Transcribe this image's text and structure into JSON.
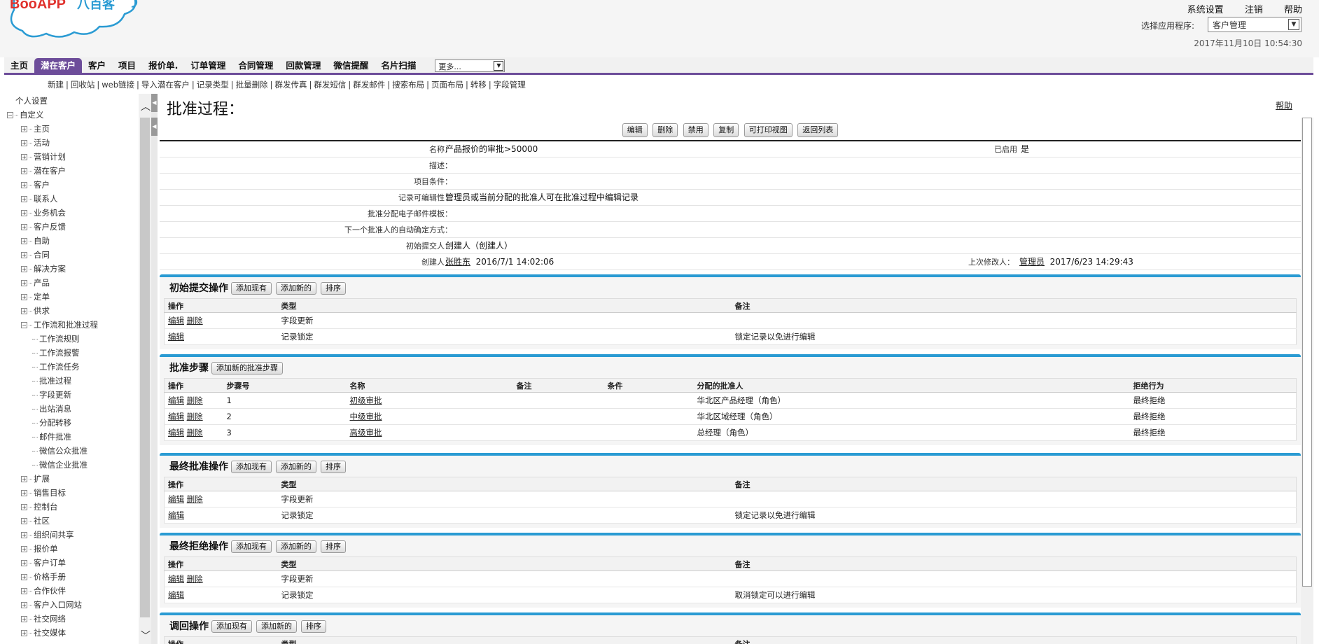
{
  "header": {
    "logo_text": "BooAPP八百客",
    "top_links": [
      "系统设置",
      "注销",
      "帮助"
    ],
    "app_select_label": "选择应用程序:",
    "app_select_value": "客户管理",
    "datetime": "2017年11月10日 10:54:30"
  },
  "nav": {
    "tabs": [
      "主页",
      "潜在客户",
      "客户",
      "项目",
      "报价单.",
      "订单管理",
      "合同管理",
      "回款管理",
      "微信提醒",
      "名片扫描"
    ],
    "active_tab": "潜在客户",
    "more_select": "更多...",
    "sub_links": [
      "新建",
      "回收站",
      "web链接",
      "导入潜在客户",
      "记录类型",
      "批量删除",
      "群发传真",
      "群发短信",
      "群发邮件",
      "搜索布局",
      "页面布局",
      "转移",
      "字段管理"
    ]
  },
  "sidebar": {
    "nodes": [
      {
        "label": "个人设置",
        "level": 0,
        "icon": "none"
      },
      {
        "label": "自定义",
        "level": 0,
        "icon": "minus"
      },
      {
        "label": "主页",
        "level": 1,
        "icon": "plus"
      },
      {
        "label": "活动",
        "level": 1,
        "icon": "plus"
      },
      {
        "label": "营销计划",
        "level": 1,
        "icon": "plus"
      },
      {
        "label": "潜在客户",
        "level": 1,
        "icon": "plus"
      },
      {
        "label": "客户",
        "level": 1,
        "icon": "plus"
      },
      {
        "label": "联系人",
        "level": 1,
        "icon": "plus"
      },
      {
        "label": "业务机会",
        "level": 1,
        "icon": "plus"
      },
      {
        "label": "客户反馈",
        "level": 1,
        "icon": "plus"
      },
      {
        "label": "自助",
        "level": 1,
        "icon": "plus"
      },
      {
        "label": "合同",
        "level": 1,
        "icon": "plus"
      },
      {
        "label": "解决方案",
        "level": 1,
        "icon": "plus"
      },
      {
        "label": "产品",
        "level": 1,
        "icon": "plus"
      },
      {
        "label": "定单",
        "level": 1,
        "icon": "plus"
      },
      {
        "label": "供求",
        "level": 1,
        "icon": "plus"
      },
      {
        "label": "工作流和批准过程",
        "level": 1,
        "icon": "minus"
      },
      {
        "label": "工作流规则",
        "level": 2,
        "icon": "line"
      },
      {
        "label": "工作流报警",
        "level": 2,
        "icon": "line"
      },
      {
        "label": "工作流任务",
        "level": 2,
        "icon": "line"
      },
      {
        "label": "批准过程",
        "level": 2,
        "icon": "line"
      },
      {
        "label": "字段更新",
        "level": 2,
        "icon": "line"
      },
      {
        "label": "出站消息",
        "level": 2,
        "icon": "line"
      },
      {
        "label": "分配转移",
        "level": 2,
        "icon": "line"
      },
      {
        "label": "邮件批准",
        "level": 2,
        "icon": "line"
      },
      {
        "label": "微信公众批准",
        "level": 2,
        "icon": "line"
      },
      {
        "label": "微信企业批准",
        "level": 2,
        "icon": "line"
      },
      {
        "label": "扩展",
        "level": 1,
        "icon": "plus"
      },
      {
        "label": "销售目标",
        "level": 1,
        "icon": "plus"
      },
      {
        "label": "控制台",
        "level": 1,
        "icon": "plus"
      },
      {
        "label": "社区",
        "level": 1,
        "icon": "plus"
      },
      {
        "label": "组织间共享",
        "level": 1,
        "icon": "plus"
      },
      {
        "label": "报价单",
        "level": 1,
        "icon": "plus"
      },
      {
        "label": "客户订单",
        "level": 1,
        "icon": "plus"
      },
      {
        "label": "价格手册",
        "level": 1,
        "icon": "plus"
      },
      {
        "label": "合作伙伴",
        "level": 1,
        "icon": "plus"
      },
      {
        "label": "客户入口网站",
        "level": 1,
        "icon": "plus"
      },
      {
        "label": "社交网络",
        "level": 1,
        "icon": "plus"
      },
      {
        "label": "社交媒体",
        "level": 1,
        "icon": "plus"
      }
    ]
  },
  "page": {
    "title": "批准过程：",
    "help_link": "帮助",
    "buttons": [
      "编辑",
      "删除",
      "禁用",
      "复制",
      "可打印视图",
      "返回列表"
    ],
    "detail": {
      "name_label": "名称：",
      "name_value": "产品报价的审批>50000",
      "active_label": "已启用",
      "active_value": "是",
      "desc_label": "描述：",
      "desc_value": "",
      "criteria_label": "项目条件：",
      "criteria_value": "",
      "editable_label": "记录可编辑性：",
      "editable_value": "管理员或当前分配的批准人可在批准过程中编辑记录",
      "email_label": "批准分配电子邮件模板：",
      "email_value": "",
      "next_label": "下一个批准人的自动确定方式：",
      "next_value": "",
      "submitter_label": "初始提交人：",
      "submitter_value": "创建人（创建人）",
      "created_label": "创建人：",
      "created_user": "张胜东",
      "created_time": "2016/7/1 14:02:06",
      "modified_label": "上次修改人：",
      "modified_user": "管理员",
      "modified_time": "2017/6/23 14:29:43"
    }
  },
  "sections": {
    "initial": {
      "title": "初始提交操作",
      "buttons": [
        "添加现有",
        "添加新的",
        "排序"
      ],
      "headers": [
        "操作",
        "类型",
        "备注"
      ],
      "rows": [
        {
          "actions": [
            "编辑",
            "删除"
          ],
          "type": "字段更新",
          "note": ""
        },
        {
          "actions": [
            "编辑"
          ],
          "type": "记录锁定",
          "note": "锁定记录以免进行编辑"
        }
      ]
    },
    "steps": {
      "title": "批准步骤",
      "buttons": [
        "添加新的批准步骤"
      ],
      "headers": [
        "操作",
        "步骤号",
        "名称",
        "备注",
        "条件",
        "分配的批准人",
        "拒绝行为"
      ],
      "rows": [
        {
          "actions": [
            "编辑",
            "删除"
          ],
          "num": "1",
          "name": "初级审批",
          "note": "",
          "cond": "",
          "approver": "华北区产品经理（角色）",
          "reject": "最终拒绝"
        },
        {
          "actions": [
            "编辑",
            "删除"
          ],
          "num": "2",
          "name": "中级审批",
          "note": "",
          "cond": "",
          "approver": "华北区域经理（角色）",
          "reject": "最终拒绝"
        },
        {
          "actions": [
            "编辑",
            "删除"
          ],
          "num": "3",
          "name": "高级审批",
          "note": "",
          "cond": "",
          "approver": "总经理（角色）",
          "reject": "最终拒绝"
        }
      ]
    },
    "final_approve": {
      "title": "最终批准操作",
      "buttons": [
        "添加现有",
        "添加新的",
        "排序"
      ],
      "headers": [
        "操作",
        "类型",
        "备注"
      ],
      "rows": [
        {
          "actions": [
            "编辑",
            "删除"
          ],
          "type": "字段更新",
          "note": ""
        },
        {
          "actions": [
            "编辑"
          ],
          "type": "记录锁定",
          "note": "锁定记录以免进行编辑"
        }
      ]
    },
    "final_reject": {
      "title": "最终拒绝操作",
      "buttons": [
        "添加现有",
        "添加新的",
        "排序"
      ],
      "headers": [
        "操作",
        "类型",
        "备注"
      ],
      "rows": [
        {
          "actions": [
            "编辑",
            "删除"
          ],
          "type": "字段更新",
          "note": ""
        },
        {
          "actions": [
            "编辑"
          ],
          "type": "记录锁定",
          "note": "取消锁定可以进行编辑"
        }
      ]
    },
    "recall": {
      "title": "调回操作",
      "buttons": [
        "添加现有",
        "添加新的",
        "排序"
      ],
      "headers": [
        "操作",
        "类型",
        "备注"
      ],
      "rows": []
    }
  },
  "colors": {
    "nav_accent": "#6d4d9a",
    "section_accent": "#2a9bd3",
    "logo_blue": "#2a9bd3",
    "logo_red": "#e0312c"
  }
}
